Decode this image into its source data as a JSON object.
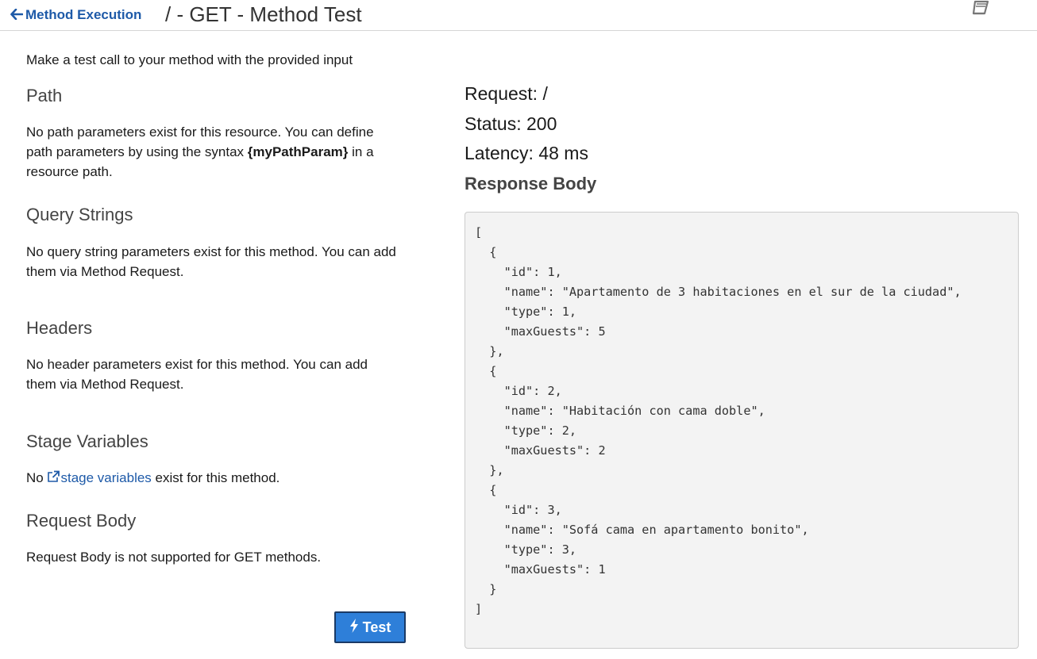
{
  "header": {
    "back_label": "Method Execution",
    "title": "/ - GET - Method Test"
  },
  "intro": "Make a test call to your method with the provided input",
  "sections": {
    "path": {
      "title": "Path",
      "text_before": "No path parameters exist for this resource. You can define path parameters by using the syntax ",
      "text_bold": "{myPathParam}",
      "text_after": " in a resource path."
    },
    "query": {
      "title": "Query Strings",
      "text": "No query string parameters exist for this method. You can add them via Method Request."
    },
    "headers": {
      "title": "Headers",
      "text": "No header parameters exist for this method. You can add them via Method Request."
    },
    "stage": {
      "title": "Stage Variables",
      "text_before": "No ",
      "link": "stage variables",
      "text_after": " exist for this method."
    },
    "request_body": {
      "title": "Request Body",
      "text": "Request Body is not supported for GET methods."
    }
  },
  "test_button": {
    "label": "Test"
  },
  "result": {
    "request": "Request: /",
    "status": "Status: 200",
    "latency": "Latency: 48 ms",
    "response_title": "Response Body",
    "response_body": "[\n  {\n    \"id\": 1,\n    \"name\": \"Apartamento de 3 habitaciones en el sur de la ciudad\",\n    \"type\": 1,\n    \"maxGuests\": 5\n  },\n  {\n    \"id\": 2,\n    \"name\": \"Habitación con cama doble\",\n    \"type\": 2,\n    \"maxGuests\": 2\n  },\n  {\n    \"id\": 3,\n    \"name\": \"Sofá cama en apartamento bonito\",\n    \"type\": 3,\n    \"maxGuests\": 1\n  }\n]"
  },
  "icons": {
    "back": "arrow-left-icon",
    "book": "book-icon",
    "external_link": "external-link-icon",
    "bolt": "bolt-icon"
  }
}
